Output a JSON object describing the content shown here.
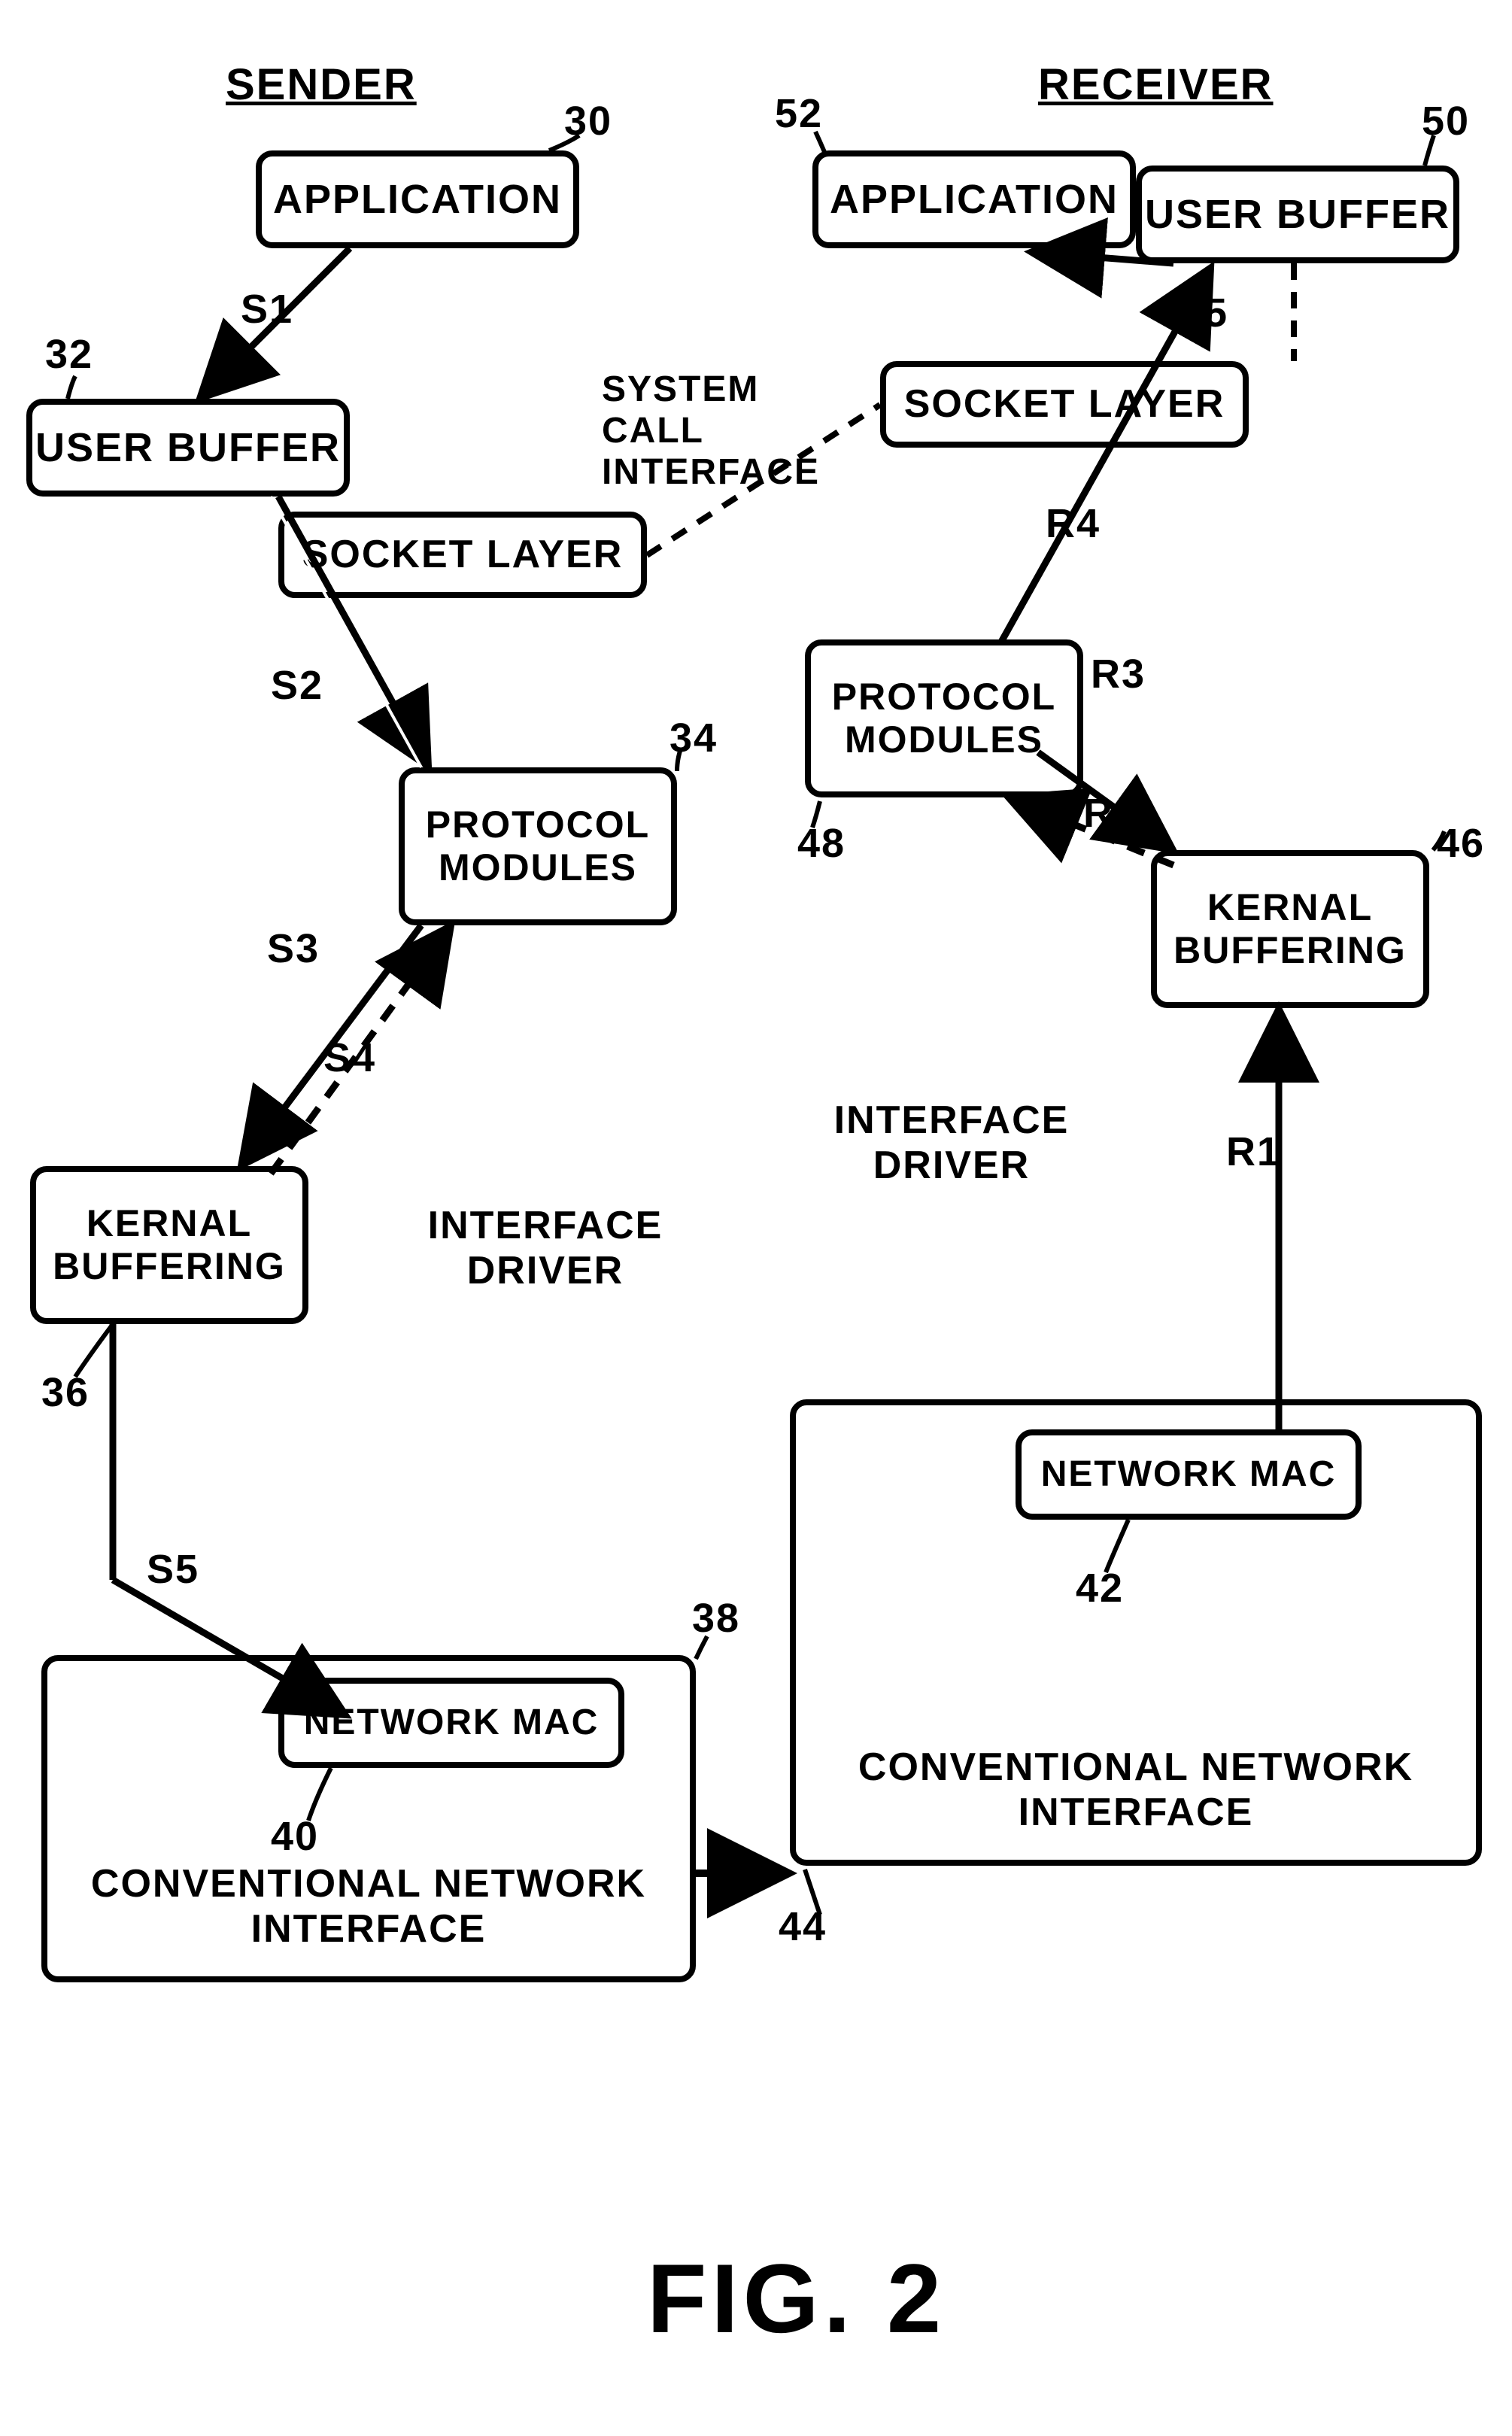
{
  "titles": {
    "sender": "SENDER",
    "receiver": "RECEIVER",
    "system_call_interface_l1": "SYSTEM",
    "system_call_interface_l2": "CALL INTERFACE"
  },
  "sender": {
    "application": "APPLICATION",
    "user_buffer": "USER BUFFER",
    "socket_layer": "SOCKET LAYER",
    "protocol_modules_l1": "PROTOCOL",
    "protocol_modules_l2": "MODULES",
    "kernal_buffering_l1": "KERNAL",
    "kernal_buffering_l2": "BUFFERING",
    "interface_driver_l1": "INTERFACE",
    "interface_driver_l2": "DRIVER",
    "network_mac": "NETWORK MAC",
    "conv_net_if": "CONVENTIONAL NETWORK INTERFACE"
  },
  "receiver": {
    "application": "APPLICATION",
    "user_buffer": "USER BUFFER",
    "socket_layer": "SOCKET LAYER",
    "protocol_modules_l1": "PROTOCOL",
    "protocol_modules_l2": "MODULES",
    "kernal_buffering_l1": "KERNAL",
    "kernal_buffering_l2": "BUFFERING",
    "interface_driver_l1": "INTERFACE",
    "interface_driver_l2": "DRIVER",
    "network_mac": "NETWORK MAC",
    "conv_net_if": "CONVENTIONAL NETWORK INTERFACE"
  },
  "steps": {
    "S1": "S1",
    "S2": "S2",
    "S3": "S3",
    "S4": "S4",
    "S5": "S5",
    "R1": "R1",
    "R2": "R2",
    "R3": "R3",
    "R4": "R4",
    "R5": "R5"
  },
  "ref": {
    "n30": "30",
    "n32": "32",
    "n34": "34",
    "n36": "36",
    "n38": "38",
    "n40": "40",
    "n42": "42",
    "n44": "44",
    "n46": "46",
    "n48": "48",
    "n50": "50",
    "n52": "52"
  },
  "figLabel": "FIG. 2"
}
